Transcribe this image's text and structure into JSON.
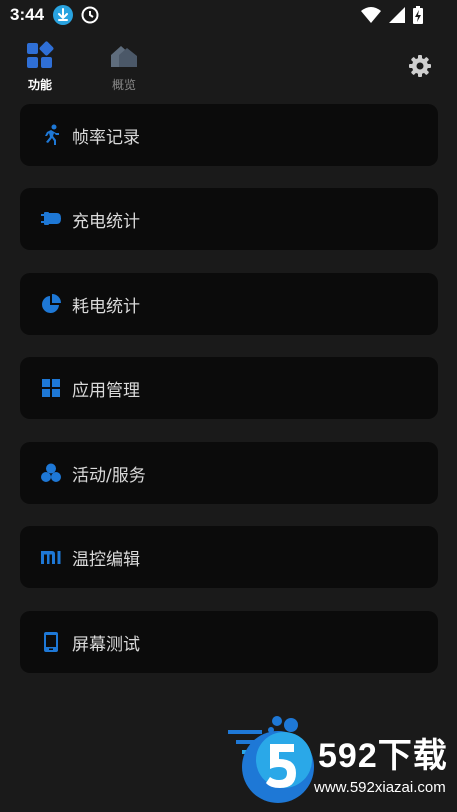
{
  "status_bar": {
    "time": "3:44"
  },
  "nav": {
    "tabs": [
      {
        "label": "功能",
        "active": true
      },
      {
        "label": "概览",
        "active": false
      }
    ]
  },
  "menu": {
    "items": [
      {
        "label": "帧率记录",
        "icon": "running-icon"
      },
      {
        "label": "充电统计",
        "icon": "plug-icon"
      },
      {
        "label": "耗电统计",
        "icon": "pie-icon"
      },
      {
        "label": "应用管理",
        "icon": "grid-icon"
      },
      {
        "label": "活动/服务",
        "icon": "cluster-icon"
      },
      {
        "label": "温控编辑",
        "icon": "mi-icon"
      },
      {
        "label": "屏幕测试",
        "icon": "phone-icon"
      }
    ]
  },
  "watermark": {
    "brand": "592下载",
    "url": "www.592xiazai.com"
  },
  "colors": {
    "accent": "#1e78d6",
    "card_bg": "#0b0b0b",
    "page_bg": "#1a1a1a"
  }
}
